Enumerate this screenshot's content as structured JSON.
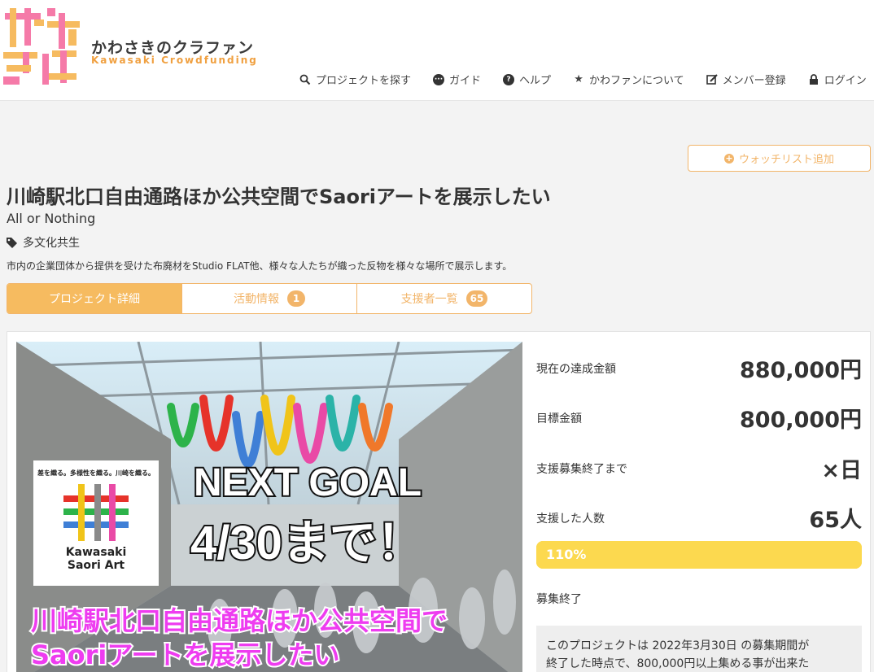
{
  "header": {
    "logo_ja": "かわさきのクラファン",
    "logo_en": "Kawasaki Crowdfunding",
    "nav": [
      {
        "label": "プロジェクトを探す",
        "icon": "search-icon"
      },
      {
        "label": "ガイド",
        "icon": "chat-icon"
      },
      {
        "label": "ヘルプ",
        "icon": "question-icon"
      },
      {
        "label": "かわファンについて",
        "icon": "star-icon"
      },
      {
        "label": "メンバー登録",
        "icon": "edit-icon"
      },
      {
        "label": "ログイン",
        "icon": "lock-icon"
      }
    ]
  },
  "watchlist_label": "ウォッチリスト追加",
  "project": {
    "title": "川崎駅北口自由通路ほか公共空間でSaoriアートを展示したい",
    "type": "All or Nothing",
    "tag": "多文化共生",
    "description": "市内の企業団体から提供を受けた布廃材をStudio FLAT他、様々な人たちが織った反物を様々な場所で展示します。"
  },
  "tabs": [
    {
      "label": "プロジェクト詳細",
      "badge": ""
    },
    {
      "label": "活動情報",
      "badge": "1"
    },
    {
      "label": "支援者一覧",
      "badge": "65"
    }
  ],
  "hero": {
    "sign_top": "差を織る。多様性を織る。川崎を織る。",
    "sign_name1": "Kawasaki",
    "sign_name2": "Saori Art",
    "goal_line1": "NEXT GOAL",
    "goal_line2": "4/30まで！",
    "caption1": "川崎駅北口自由通路ほか公共空間で",
    "caption2": "Saoriアートを展示したい"
  },
  "stats": {
    "current_label": "現在の達成金額",
    "current_value": "880,000円",
    "goal_label": "目標金額",
    "goal_value": "800,000円",
    "remaining_label": "支援募集終了まで",
    "remaining_value": "×日",
    "backers_label": "支援した人数",
    "backers_value": "65人",
    "progress_label": "110%",
    "progress_fraction": 1.1,
    "status": "募集終了",
    "note_line1": "このプロジェクトは 2022年3月30日 の募集期間が",
    "note_line2": "終了した時点で、800,000円以上集める事が出来た"
  },
  "colors": {
    "accent": "#f6bb60",
    "progress": "#fcd94f",
    "caption_magenta": "#ee3cf0"
  }
}
